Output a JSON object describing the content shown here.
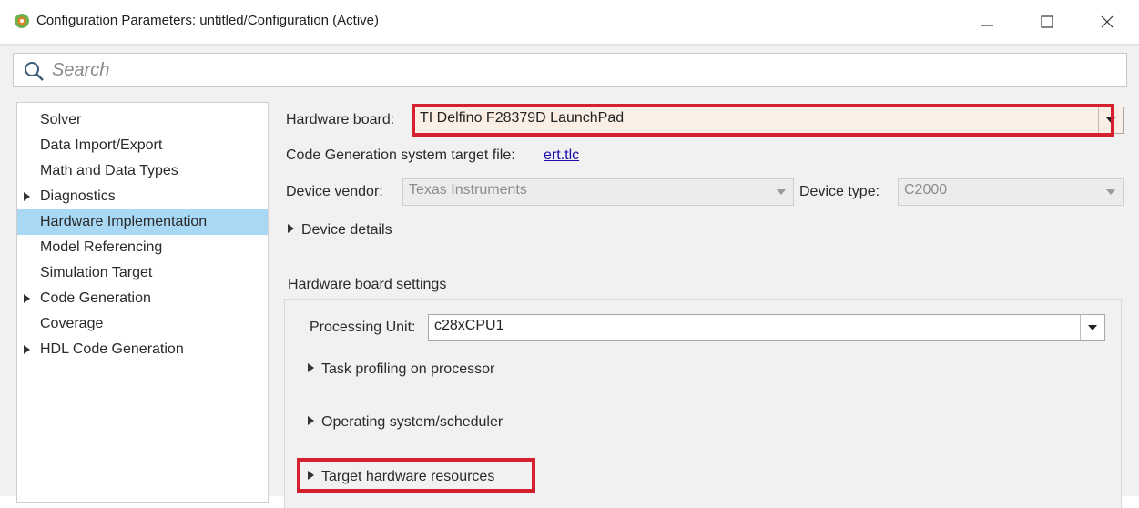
{
  "window": {
    "title": "Configuration Parameters: untitled/Configuration (Active)",
    "app_icon": "matlab-gear-icon",
    "controls": [
      "minimize-icon",
      "maximize-icon",
      "close-icon"
    ]
  },
  "search": {
    "placeholder": "Search",
    "icon": "search-icon"
  },
  "sidebar": {
    "items": [
      {
        "label": "Solver",
        "expandable": false,
        "selected": false
      },
      {
        "label": "Data Import/Export",
        "expandable": false,
        "selected": false
      },
      {
        "label": "Math and Data Types",
        "expandable": false,
        "selected": false
      },
      {
        "label": "Diagnostics",
        "expandable": true,
        "selected": false
      },
      {
        "label": "Hardware Implementation",
        "expandable": false,
        "selected": true
      },
      {
        "label": "Model Referencing",
        "expandable": false,
        "selected": false
      },
      {
        "label": "Simulation Target",
        "expandable": false,
        "selected": false
      },
      {
        "label": "Code Generation",
        "expandable": true,
        "selected": false
      },
      {
        "label": "Coverage",
        "expandable": false,
        "selected": false
      },
      {
        "label": "HDL Code Generation",
        "expandable": true,
        "selected": false
      }
    ]
  },
  "main": {
    "hardware_board": {
      "label": "Hardware board:",
      "value": "TI Delfino F28379D LaunchPad"
    },
    "target_file": {
      "label": "Code Generation system target file:",
      "link": "ert.tlc"
    },
    "device_vendor": {
      "label": "Device vendor:",
      "value": "Texas Instruments"
    },
    "device_type": {
      "label": "Device type:",
      "value": "C2000"
    },
    "device_details": "Device details",
    "board_settings": {
      "title": "Hardware board settings",
      "processing_unit": {
        "label": "Processing Unit:",
        "value": "c28xCPU1"
      },
      "sections": [
        "Task profiling on processor",
        "Operating system/scheduler",
        "Target hardware resources"
      ]
    }
  },
  "colors": {
    "highlight_border": "#d5202f",
    "selected_item": "#a9d8f5",
    "link": "#1a0dab",
    "panel_bg": "#f1f1f1",
    "hardware_board_bg": "#fbeee4"
  }
}
